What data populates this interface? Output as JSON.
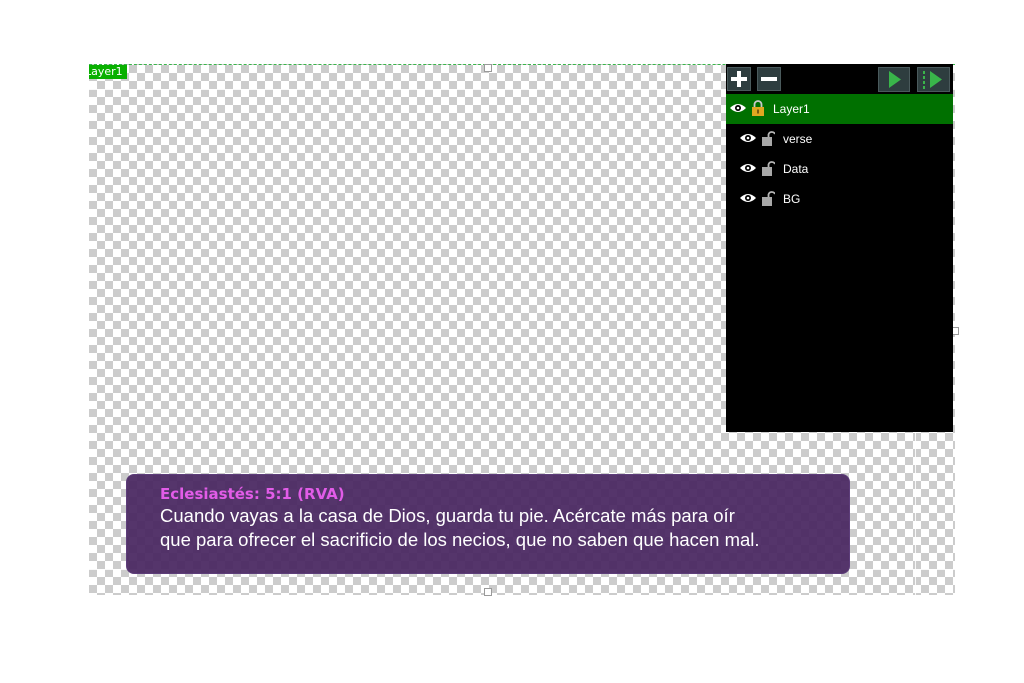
{
  "canvas": {
    "tag_label": "Layer1"
  },
  "lower_third": {
    "reference": "Eclesiastés: 5:1 (RVA)",
    "line1": "Cuando vayas a la casa de Dios, guarda tu pie. Acércate más para oír",
    "line2": "que para ofrecer el sacrificio de los necios, que no saben que hacen mal.",
    "colors": {
      "background": "#482660",
      "reference": "#e25ce8",
      "text": "#ffffff"
    }
  },
  "layers_panel": {
    "toolbar": [
      "add-icon",
      "remove-icon",
      "play-icon",
      "play-step-icon"
    ],
    "layers": [
      {
        "name": "Layer1",
        "selected": true,
        "visible": true,
        "locked": true
      },
      {
        "name": "verse",
        "selected": false,
        "visible": true,
        "locked": false
      },
      {
        "name": "Data",
        "selected": false,
        "visible": true,
        "locked": false
      },
      {
        "name": "BG",
        "selected": false,
        "visible": true,
        "locked": false
      }
    ],
    "colors": {
      "selected": "#007000",
      "background": "#000000",
      "play": "#39b54a"
    }
  }
}
